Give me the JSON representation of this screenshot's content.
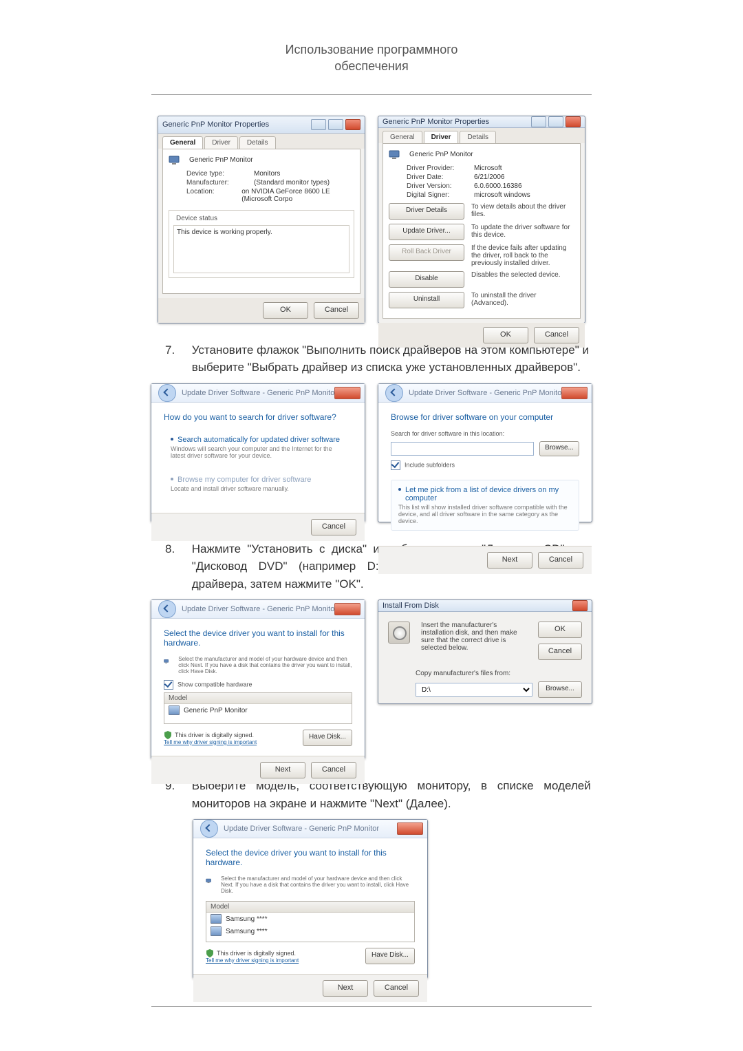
{
  "header": {
    "line1": "Использование программного",
    "line2": "обеспечения"
  },
  "step7": {
    "num": "7.",
    "text": "Установите флажок \"Выполнить поиск драйверов на этом компьютере\" и выберите \"Выбрать драйвер из списка уже установленных драйверов\"."
  },
  "step8": {
    "num": "8.",
    "text": "Нажмите \"Установить с диска\" и выберите папку \"Дисковод CD\" или \"Дисковод DVD\" (например D:\\), где находится файл установки драйвера, затем нажмите \"OK\"."
  },
  "step9": {
    "num": "9.",
    "text": "Выберите модель, соответствующую монитору, в списке моделей мониторов на экране и нажмите \"Next\" (Далее)."
  },
  "propsGeneral": {
    "title": "Generic PnP Monitor Properties",
    "tabs": {
      "general": "General",
      "driver": "Driver",
      "details": "Details"
    },
    "deviceName": "Generic PnP Monitor",
    "kv": {
      "deviceType_k": "Device type:",
      "deviceType_v": "Monitors",
      "manufacturer_k": "Manufacturer:",
      "manufacturer_v": "(Standard monitor types)",
      "location_k": "Location:",
      "location_v": "on NVIDIA GeForce 8600 LE (Microsoft Corpo"
    },
    "statusLabel": "Device status",
    "statusText": "This device is working properly.",
    "ok": "OK",
    "cancel": "Cancel"
  },
  "propsDriver": {
    "title": "Generic PnP Monitor Properties",
    "tabs": {
      "general": "General",
      "driver": "Driver",
      "details": "Details"
    },
    "deviceName": "Generic PnP Monitor",
    "kv": {
      "provider_k": "Driver Provider:",
      "provider_v": "Microsoft",
      "date_k": "Driver Date:",
      "date_v": "6/21/2006",
      "version_k": "Driver Version:",
      "version_v": "6.0.6000.16386",
      "signer_k": "Digital Signer:",
      "signer_v": "microsoft windows"
    },
    "btns": {
      "details": "Driver Details",
      "details_d": "To view details about the driver files.",
      "update": "Update Driver...",
      "update_d": "To update the driver software for this device.",
      "rollback": "Roll Back Driver",
      "rollback_d": "If the device fails after updating the driver, roll back to the previously installed driver.",
      "disable": "Disable",
      "disable_d": "Disables the selected device.",
      "uninstall": "Uninstall",
      "uninstall_d": "To uninstall the driver (Advanced)."
    },
    "ok": "OK",
    "cancel": "Cancel"
  },
  "wiz1": {
    "crumb": "Update Driver Software - Generic PnP Monitor",
    "heading": "How do you want to search for driver software?",
    "opt1_t": "Search automatically for updated driver software",
    "opt1_d": "Windows will search your computer and the Internet for the latest driver software for your device.",
    "opt2_t": "Browse my computer for driver software",
    "opt2_d": "Locate and install driver software manually.",
    "cancel": "Cancel"
  },
  "wiz2": {
    "crumb": "Update Driver Software - Generic PnP Monitor",
    "heading": "Browse for driver software on your computer",
    "searchLbl": "Search for driver software in this location:",
    "browse": "Browse...",
    "includeSub": "Include subfolders",
    "opt_t": "Let me pick from a list of device drivers on my computer",
    "opt_d": "This list will show installed driver software compatible with the device, and all driver software in the same category as the device.",
    "next": "Next",
    "cancel": "Cancel"
  },
  "wiz3": {
    "crumb": "Update Driver Software - Generic PnP Monitor",
    "heading": "Select the device driver you want to install for this hardware.",
    "sub": "Select the manufacturer and model of your hardware device and then click Next. If you have a disk that contains the driver you want to install, click Have Disk.",
    "showCompat": "Show compatible hardware",
    "modelHdr": "Model",
    "model1": "Generic PnP Monitor",
    "signed": "This driver is digitally signed.",
    "tell": "Tell me why driver signing is important",
    "haveDisk": "Have Disk...",
    "next": "Next",
    "cancel": "Cancel"
  },
  "instDisk": {
    "title": "Install From Disk",
    "msg": "Insert the manufacturer's installation disk, and then make sure that the correct drive is selected below.",
    "copyLbl": "Copy manufacturer's files from:",
    "path": "D:\\",
    "ok": "OK",
    "cancel": "Cancel",
    "browse": "Browse..."
  },
  "wiz4": {
    "crumb": "Update Driver Software - Generic PnP Monitor",
    "heading": "Select the device driver you want to install for this hardware.",
    "sub": "Select the manufacturer and model of your hardware device and then click Next. If you have a disk that contains the driver you want to install, click Have Disk.",
    "modelHdr": "Model",
    "model1": "Samsung ****",
    "model2": "Samsung ****",
    "signed": "This driver is digitally signed.",
    "tell": "Tell me why driver signing is important",
    "haveDisk": "Have Disk...",
    "next": "Next",
    "cancel": "Cancel"
  }
}
